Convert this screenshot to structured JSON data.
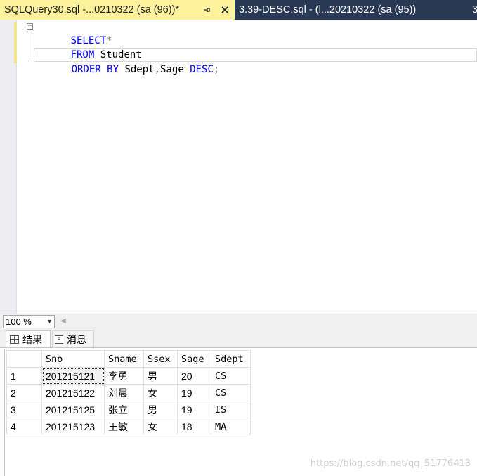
{
  "tabs": [
    {
      "title": "SQLQuery30.sql -...0210322 (sa (96))*",
      "active": true
    },
    {
      "title": "3.39-DESC.sql - (l...20210322 (sa (95))",
      "active": false
    },
    {
      "title": "3",
      "active": false
    }
  ],
  "icons": {
    "pin": "pin-icon",
    "close": "close-icon",
    "fold": "collapse-icon",
    "results_tab": "grid-icon",
    "messages_tab": "message-icon"
  },
  "editor": {
    "fold_symbol": "−",
    "lines": [
      [
        {
          "text": "SELECT",
          "kind": "keyword"
        },
        {
          "text": "*",
          "kind": "operator"
        }
      ],
      [
        {
          "text": "FROM",
          "kind": "keyword"
        },
        {
          "text": " Student",
          "kind": "text"
        }
      ],
      [
        {
          "text": "ORDER BY",
          "kind": "keyword"
        },
        {
          "text": " Sdept",
          "kind": "text"
        },
        {
          "text": ",",
          "kind": "operator"
        },
        {
          "text": "Sage ",
          "kind": "text"
        },
        {
          "text": "DESC",
          "kind": "keyword"
        },
        {
          "text": ";",
          "kind": "operator"
        }
      ]
    ]
  },
  "zoom": {
    "value": "100 %"
  },
  "results_tabs": {
    "results": "结果",
    "messages": "消息"
  },
  "results": {
    "columns": [
      "",
      "Sno",
      "Sname",
      "Ssex",
      "Sage",
      "Sdept"
    ],
    "rows": [
      [
        "1",
        "201215121",
        "李勇",
        "男",
        "20",
        "CS"
      ],
      [
        "2",
        "201215122",
        "刘晨",
        "女",
        "19",
        "CS"
      ],
      [
        "3",
        "201215125",
        "张立",
        "男",
        "19",
        "IS"
      ],
      [
        "4",
        "201215123",
        "王敏",
        "女",
        "18",
        "MA"
      ]
    ]
  },
  "watermark": "https://blog.csdn.net/qq_51776413",
  "colors": {
    "tab_strip": "#293955",
    "active_tab": "#fff29d",
    "keyword": "#0000ff",
    "operator": "#808080"
  }
}
